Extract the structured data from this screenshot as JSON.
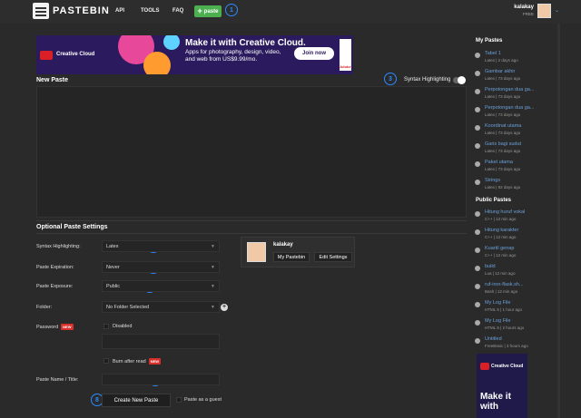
{
  "header": {
    "logo": "PASTEBIN",
    "nav": [
      "API",
      "TOOLS",
      "FAQ"
    ],
    "paste_button": "paste",
    "username": "kalakay",
    "plan": "FREE"
  },
  "markers": [
    "1",
    "2",
    "3",
    "4",
    "5",
    "6",
    "7",
    "8"
  ],
  "ad_banner": {
    "brand": "Creative Cloud",
    "headline": "Make it with Creative Cloud.",
    "body": "Apps for photography, design, video, and web from US$9.99/mo.",
    "cta": "Join now",
    "sponsor": "Adobe"
  },
  "editor": {
    "title": "New Paste",
    "syntax_toggle_label": "Syntax Highlighting"
  },
  "settings": {
    "title": "Optional Paste Settings",
    "syntax_label": "Syntax Highlighting:",
    "syntax_value": "Latex",
    "expiration_label": "Paste Expiration:",
    "expiration_value": "Never",
    "exposure_label": "Paste Exposure:",
    "exposure_value": "Public",
    "folder_label": "Folder:",
    "folder_value": "No Folder Selected",
    "password_label": "Password",
    "new_badge": "NEW",
    "password_disabled": "Disabled",
    "burn_label": "Burn after read",
    "name_label": "Paste Name / Title:",
    "create_button": "Create New Paste",
    "guest_label": "Paste as a guest"
  },
  "user_card": {
    "username": "kalakay",
    "my_pastebin": "My Pastebin",
    "edit_settings": "Edit Settings"
  },
  "sidebar": {
    "my_pastes_title": "My Pastes",
    "my_pastes": [
      {
        "title": "Tabel 1",
        "meta": "Latex | 2 days ago"
      },
      {
        "title": "Gambar akhir",
        "meta": "Latex | 73 days ago"
      },
      {
        "title": "Perpotongan dua ga...",
        "meta": "Latex | 73 days ago"
      },
      {
        "title": "Perpotongan dua ga...",
        "meta": "Latex | 73 days ago"
      },
      {
        "title": "Koordinat utama",
        "meta": "Latex | 73 days ago"
      },
      {
        "title": "Garis bagi sudut",
        "meta": "Latex | 73 days ago"
      },
      {
        "title": "Paket utama",
        "meta": "Latex | 73 days ago"
      },
      {
        "title": "Strings",
        "meta": "Latex | 82 days ago"
      }
    ],
    "public_pastes_title": "Public Pastes",
    "public_pastes": [
      {
        "title": "Hitung huruf vokal",
        "meta": "C++ | 12 min ago"
      },
      {
        "title": "Hitung karakter",
        "meta": "C++ | 12 min ago"
      },
      {
        "title": "Kuartil genap",
        "meta": "C++ | 12 min ago"
      },
      {
        "title": "build",
        "meta": "Lua | 12 min ago"
      },
      {
        "title": "ruf-iron-flask.sh...",
        "meta": "Bash | 12 min ago"
      },
      {
        "title": "My Log File",
        "meta": "HTML 5 | 1 hour ago"
      },
      {
        "title": "My Log File",
        "meta": "HTML 5 | 2 hours ago"
      },
      {
        "title": "Untitled",
        "meta": "FreeBasic | 3 hours ago"
      }
    ],
    "ad_brand": "Creative Cloud",
    "ad_text": "Make it with"
  }
}
